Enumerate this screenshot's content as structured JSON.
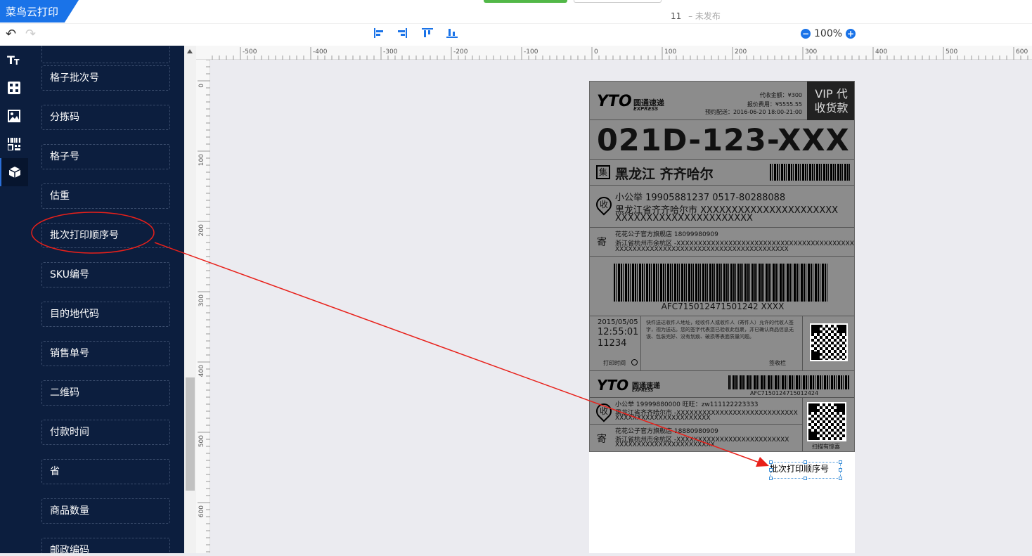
{
  "app": {
    "brand": "菜鸟云打印"
  },
  "document": {
    "title": "11",
    "status": "– 未发布"
  },
  "toolbar": {
    "zoom": "100%"
  },
  "sidebar_icons": [
    "text-icon",
    "component-icon",
    "image-icon",
    "barcode-icon",
    "box-icon"
  ],
  "panel": {
    "items": [
      "格子批次号",
      "分拣码",
      "格子号",
      "估重",
      "批次打印顺序号",
      "SKU编号",
      "目的地代码",
      "销售单号",
      "二维码",
      "付款时间",
      "省",
      "商品数量",
      "邮政编码"
    ],
    "highlighted_index": 4
  },
  "ruler": {
    "h_labels": [
      "-500",
      "-400",
      "-300",
      "-200",
      "-100",
      "0",
      "100",
      "200",
      "300",
      "400",
      "500",
      "600"
    ],
    "v_labels": [
      "0",
      "100",
      "200",
      "300",
      "400",
      "500",
      "600"
    ]
  },
  "label": {
    "brand_cn": "圆通速递",
    "brand_en": "EXPRESS",
    "cod_amount": "代收金额：¥300",
    "insured_fee": "报价费用：¥5555.55",
    "scheduled": "预约配送：2016-06-20 18:00-21:00",
    "vip_line1": "VIP 代",
    "vip_line2": "收货款",
    "sort_code": "021D-123-XXX",
    "collect_mark": "集",
    "destination": "黑龙江 齐齐哈尔",
    "receiver_mark": "收",
    "receiver_name_phone": "小公举    19905881237    0517-80288088",
    "receiver_addr_1": "黑龙江省齐齐哈尔市 XXXXXXXXXXXXXXXXXXXXXX",
    "receiver_addr_2": "XXXXXXXXXXXXXXXXXXXXXX",
    "sender_mark": "寄",
    "sender_name_phone": "花花公子官方旗舰店   18099980909",
    "sender_addr_1": "浙江省杭州市余杭区 -XXXXXXXXXXXXXXXXXXXXXXXXXXXXXXXXXXXXXXXXXX",
    "sender_addr_2": "XXXXXXXXXXXXXXXXXXXXXXXXXXXXXXXXXXXXXXXX",
    "tracking": "AFC715012471501242 XXXX",
    "date": "2015/05/05",
    "time": "12:55:01",
    "batch": "11234",
    "print_time_label": "打印时间",
    "notice": "快件送达收件人地址，经收件人或收件人（寄件人）允许的代收人签字，视为送达。您的签字代表您已验收此包裹，并已确认商品信息无误、包装完好、没有划痕、破损等表面质量问题。",
    "sign_label": "签收栏",
    "tracking_2": "AFC7150124715012424",
    "r2_name_phone": "小公举    19999880000    旺旺：zw111122223333",
    "r2_addr_1": "黑龙江省齐齐哈尔市 -XXXXXXXXXXXXXXXXXXXXXXXXXXXX",
    "r2_addr_2": "XXXXXXXXXXXXXXXXXXXXXX",
    "s2_name_phone": "花花公子官方旗舰店    18880980909",
    "s2_addr_1": "浙江省杭州市余杭区 -XXXXXXXXXXXXXXXXXXXXXXXXXX",
    "s2_addr_2": "XXXXXXXXXXXXXXXXXXXXXXX",
    "qr_caption": "扫描有惊喜"
  },
  "selected_field": {
    "text": "批次打印顺序号"
  },
  "annotation": {
    "color": "#e8201a"
  }
}
